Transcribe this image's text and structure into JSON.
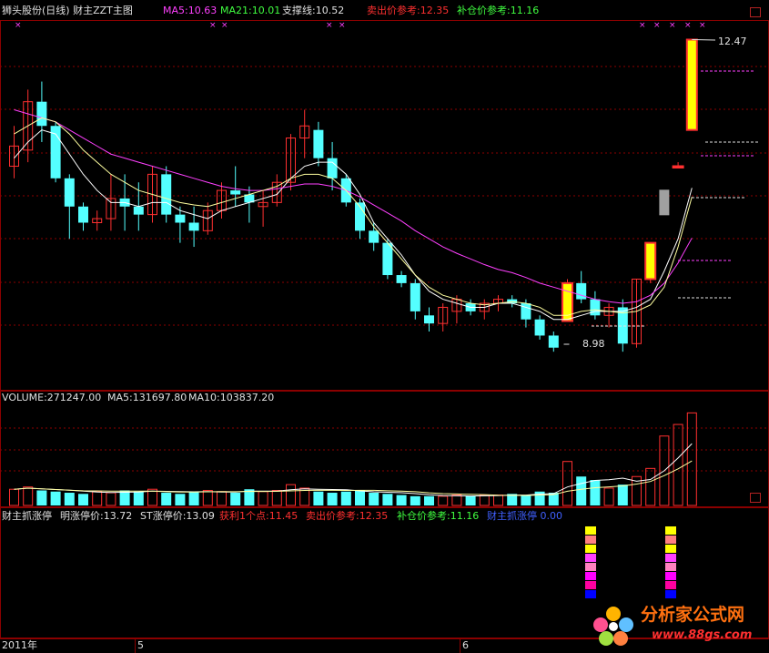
{
  "header": {
    "title": "狮头股份(日线) 财主ZZT主图",
    "ma5": "MA5:10.63",
    "ma21": "MA21:10.01",
    "support": "支撑线:10.52",
    "sell_ref": "卖出价参考:12.35",
    "buy_ref": "补仓价参考:11.16"
  },
  "price_labels": {
    "high": "12.47",
    "low": "8.98"
  },
  "volume_header": {
    "volume": "VOLUME:271247.00",
    "ma5": "MA5:131697.80",
    "ma10": "MA10:103837.20"
  },
  "indicator_header": {
    "name": "财主抓涨停",
    "ming": "明涨停价:13.72",
    "st": "ST涨停价:13.09",
    "profit": "获利1个点:11.45",
    "sell": "卖出价参考:12.35",
    "buy": "补仓价参考:11.16",
    "zt": "财主抓涨停 0.00"
  },
  "axis": {
    "year": "2011年",
    "m5": "5",
    "m6": "6"
  },
  "watermark": {
    "cn": "分析家公式网",
    "url": "www.88gs.com"
  },
  "colors": {
    "up": "#ff3030",
    "down": "#54ffff",
    "grid": "#8b0000",
    "limit": "#ffff00"
  },
  "chart_data": {
    "type": "candlestick",
    "ohlc": [
      [
        10.9,
        11.4,
        10.75,
        11.15
      ],
      [
        11.1,
        11.85,
        10.95,
        11.7
      ],
      [
        11.7,
        11.95,
        11.2,
        11.4
      ],
      [
        11.4,
        11.45,
        10.7,
        10.75
      ],
      [
        10.75,
        10.8,
        10.0,
        10.4
      ],
      [
        10.4,
        10.45,
        10.1,
        10.2
      ],
      [
        10.2,
        10.35,
        10.1,
        10.25
      ],
      [
        10.25,
        10.8,
        10.1,
        10.5
      ],
      [
        10.5,
        10.8,
        10.1,
        10.4
      ],
      [
        10.4,
        10.7,
        10.1,
        10.3
      ],
      [
        10.3,
        10.9,
        10.2,
        10.8
      ],
      [
        10.8,
        10.9,
        10.2,
        10.3
      ],
      [
        10.3,
        10.4,
        9.95,
        10.2
      ],
      [
        10.2,
        10.4,
        9.9,
        10.1
      ],
      [
        10.1,
        10.45,
        10.05,
        10.35
      ],
      [
        10.35,
        10.7,
        10.25,
        10.6
      ],
      [
        10.6,
        10.9,
        10.4,
        10.55
      ],
      [
        10.55,
        10.65,
        10.2,
        10.45
      ],
      [
        10.4,
        10.6,
        10.15,
        10.45
      ],
      [
        10.45,
        10.8,
        10.4,
        10.7
      ],
      [
        10.7,
        11.3,
        10.6,
        11.25
      ],
      [
        11.25,
        11.6,
        11.0,
        11.4
      ],
      [
        11.35,
        11.45,
        10.9,
        11.0
      ],
      [
        11.0,
        11.2,
        10.6,
        10.75
      ],
      [
        10.75,
        10.8,
        10.4,
        10.45
      ],
      [
        10.45,
        10.5,
        10.0,
        10.1
      ],
      [
        10.1,
        10.2,
        9.85,
        9.95
      ],
      [
        9.95,
        10.0,
        9.5,
        9.55
      ],
      [
        9.55,
        9.6,
        9.4,
        9.45
      ],
      [
        9.45,
        9.5,
        9.0,
        9.1
      ],
      [
        9.05,
        9.15,
        8.85,
        8.95
      ],
      [
        8.95,
        9.2,
        8.85,
        9.15
      ],
      [
        9.1,
        9.3,
        8.95,
        9.25
      ],
      [
        9.2,
        9.25,
        9.05,
        9.1
      ],
      [
        9.1,
        9.25,
        9.0,
        9.2
      ],
      [
        9.2,
        9.3,
        9.1,
        9.25
      ],
      [
        9.25,
        9.3,
        9.15,
        9.2
      ],
      [
        9.2,
        9.25,
        8.9,
        9.0
      ],
      [
        9.0,
        9.05,
        8.75,
        8.8
      ],
      [
        8.8,
        8.85,
        8.6,
        8.65
      ],
      [
        8.98,
        9.5,
        8.98,
        9.45
      ],
      [
        9.45,
        9.6,
        9.2,
        9.25
      ],
      [
        9.25,
        9.35,
        9.0,
        9.05
      ],
      [
        9.05,
        9.2,
        8.9,
        9.15
      ],
      [
        9.15,
        9.25,
        8.6,
        8.7
      ],
      [
        8.7,
        9.5,
        8.65,
        9.5
      ],
      [
        9.5,
        9.95,
        9.45,
        9.95
      ],
      [
        10.45,
        10.5,
        10.4,
        10.45
      ],
      [
        10.9,
        10.95,
        10.9,
        10.9
      ],
      [
        11.35,
        12.47,
        11.35,
        12.47
      ]
    ],
    "volume": [
      14,
      16,
      13,
      12,
      11,
      10,
      12,
      11,
      13,
      12,
      14,
      11,
      10,
      12,
      13,
      12,
      11,
      14,
      12,
      13,
      18,
      15,
      12,
      11,
      12,
      13,
      11,
      10,
      9,
      8,
      8,
      8,
      9,
      8,
      9,
      9,
      10,
      9,
      12,
      11,
      38,
      25,
      22,
      15,
      18,
      25,
      32,
      60,
      70,
      80
    ],
    "series": [
      {
        "name": "MA5",
        "values": [
          11.0,
          11.2,
          11.35,
          11.3,
          11.05,
          10.8,
          10.6,
          10.45,
          10.45,
          10.4,
          10.45,
          10.45,
          10.35,
          10.3,
          10.25,
          10.35,
          10.4,
          10.45,
          10.5,
          10.55,
          10.75,
          10.9,
          10.95,
          10.95,
          10.8,
          10.55,
          10.2,
          10.0,
          9.8,
          9.55,
          9.35,
          9.25,
          9.2,
          9.15,
          9.15,
          9.2,
          9.2,
          9.15,
          9.1,
          9.0,
          9.0,
          9.05,
          9.1,
          9.1,
          9.1,
          9.15,
          9.25,
          9.6,
          10.0,
          10.63
        ]
      },
      {
        "name": "MA21",
        "values": [
          11.6,
          11.55,
          11.5,
          11.45,
          11.35,
          11.25,
          11.15,
          11.05,
          11.0,
          10.95,
          10.9,
          10.85,
          10.8,
          10.75,
          10.7,
          10.65,
          10.62,
          10.6,
          10.6,
          10.62,
          10.65,
          10.68,
          10.68,
          10.65,
          10.6,
          10.52,
          10.42,
          10.32,
          10.22,
          10.1,
          10.0,
          9.9,
          9.82,
          9.75,
          9.68,
          9.62,
          9.58,
          9.52,
          9.45,
          9.4,
          9.35,
          9.3,
          9.25,
          9.22,
          9.2,
          9.22,
          9.3,
          9.45,
          9.7,
          10.01
        ]
      },
      {
        "name": "支撑线",
        "values": [
          11.3,
          11.4,
          11.5,
          11.45,
          11.3,
          11.1,
          10.95,
          10.8,
          10.7,
          10.6,
          10.55,
          10.5,
          10.45,
          10.42,
          10.4,
          10.45,
          10.5,
          10.55,
          10.6,
          10.65,
          10.75,
          10.8,
          10.8,
          10.75,
          10.6,
          10.4,
          10.15,
          9.95,
          9.75,
          9.55,
          9.4,
          9.3,
          9.25,
          9.2,
          9.18,
          9.2,
          9.22,
          9.2,
          9.15,
          9.05,
          9.05,
          9.1,
          9.12,
          9.1,
          9.08,
          9.1,
          9.18,
          9.4,
          9.9,
          10.52
        ]
      }
    ]
  }
}
